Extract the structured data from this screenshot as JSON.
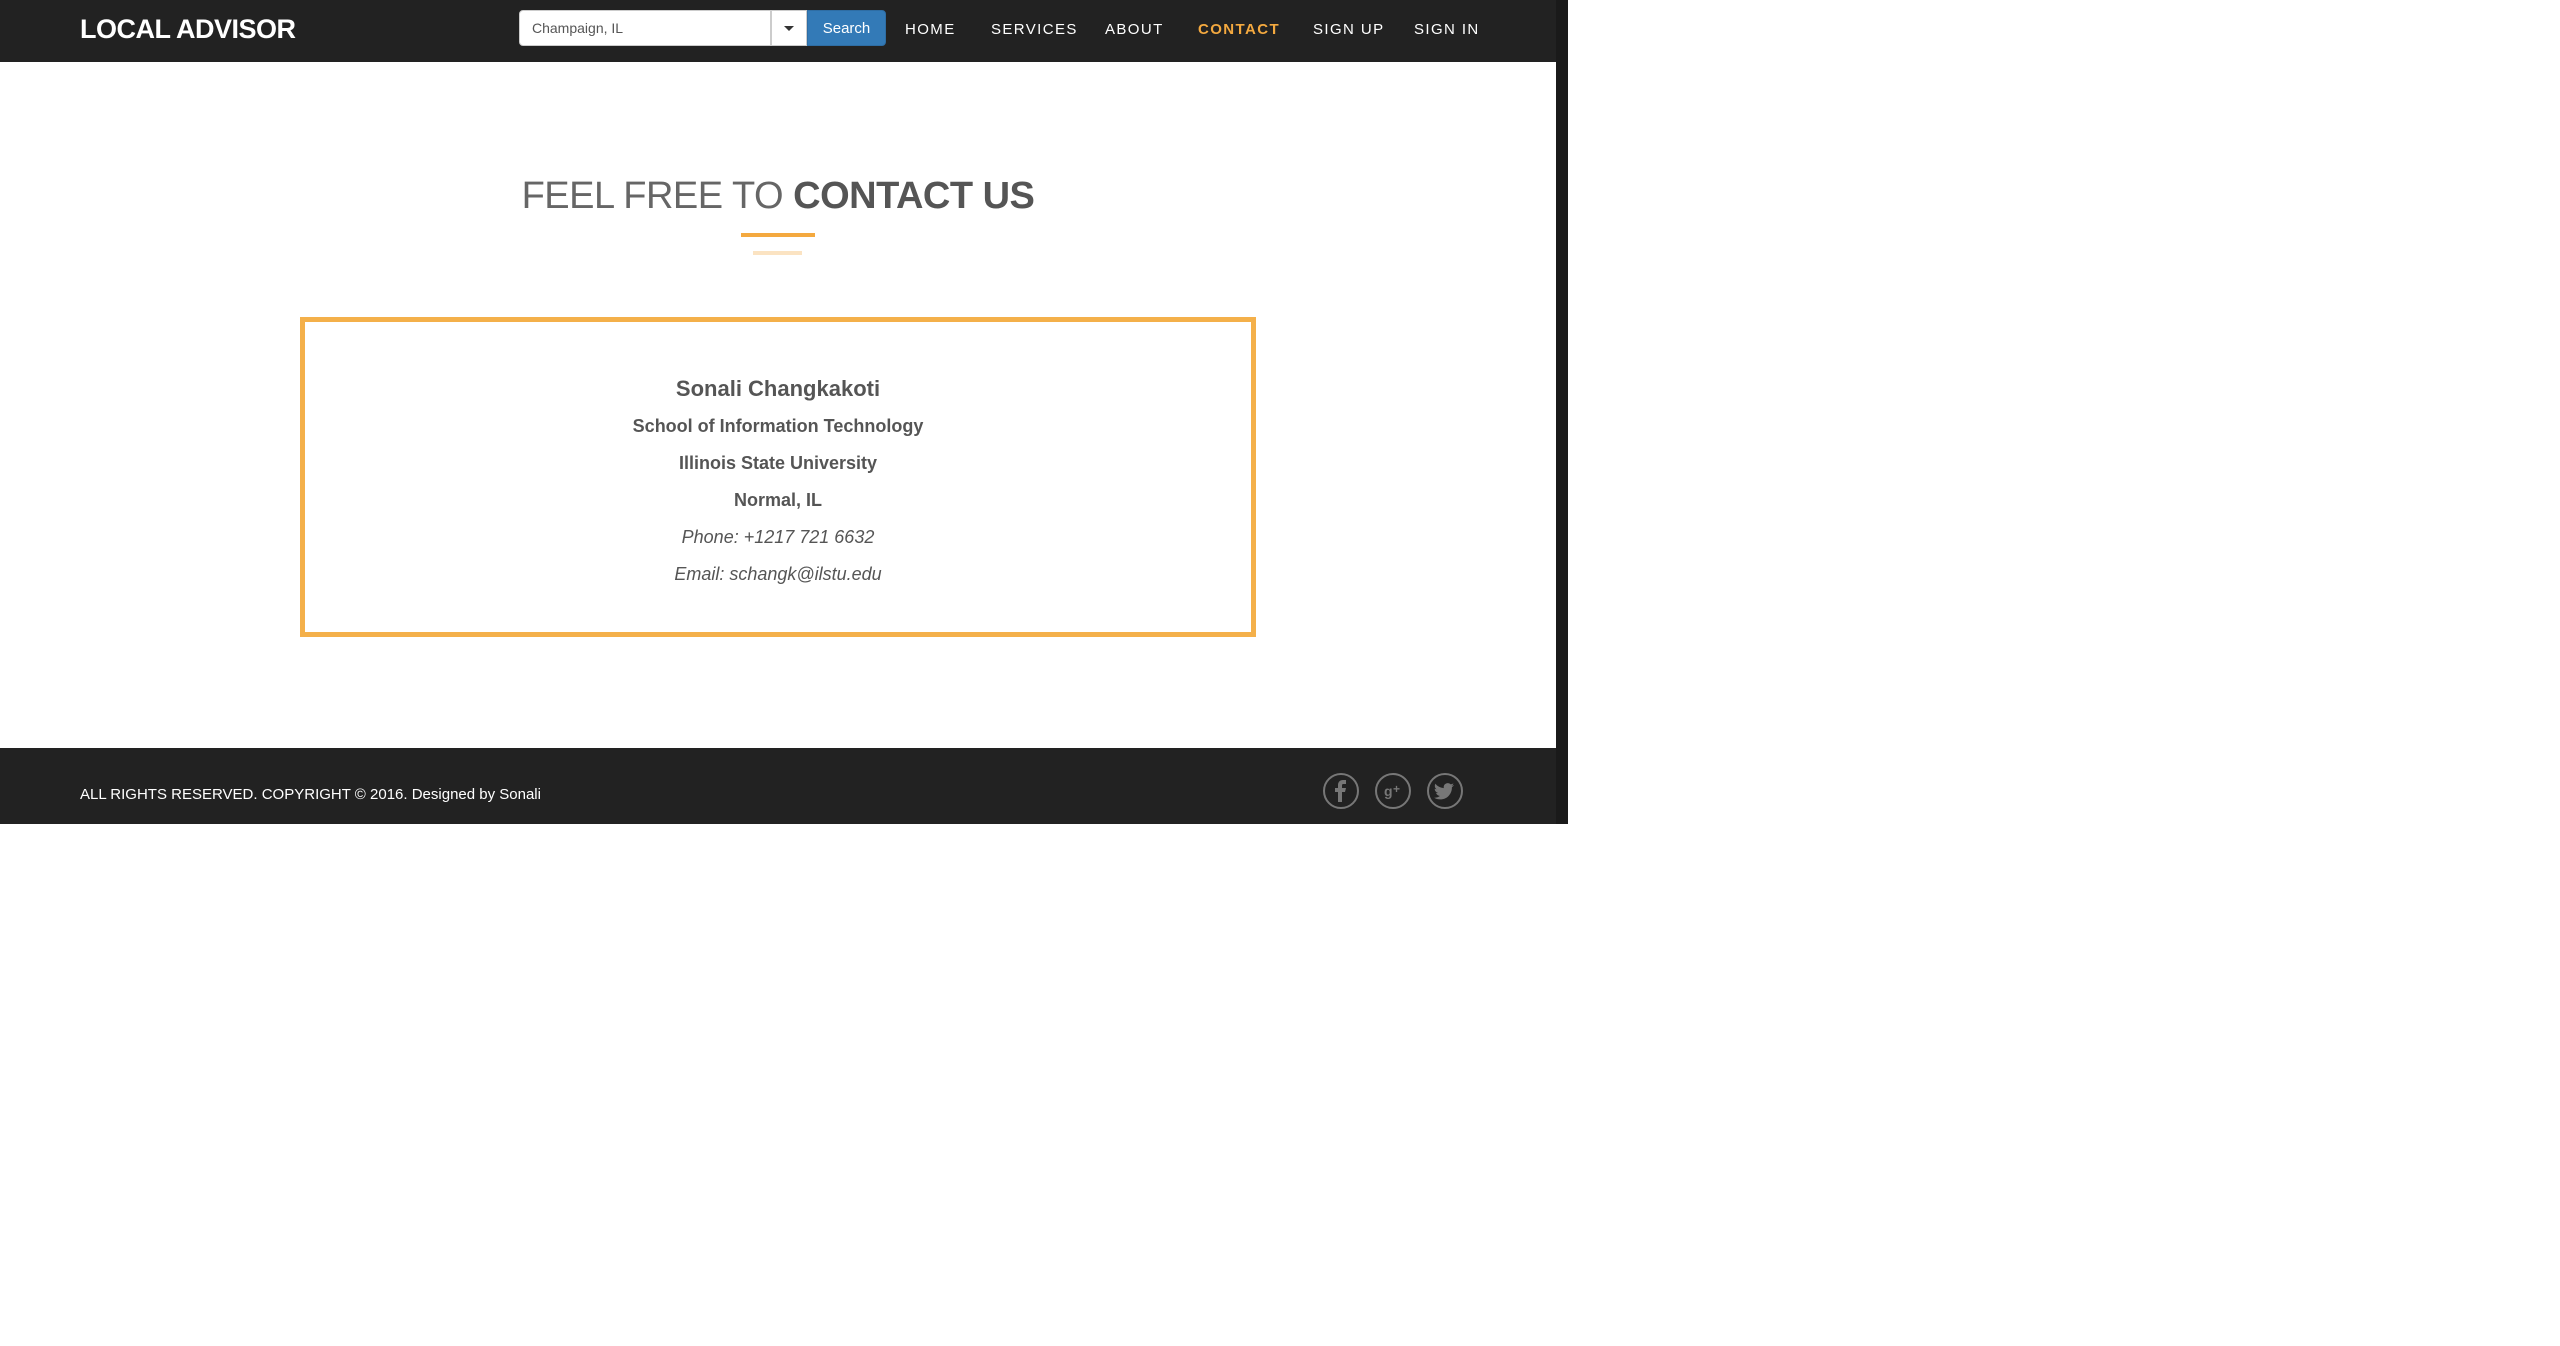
{
  "brand": "LOCAL ADVISOR",
  "search": {
    "value": "Champaign, IL",
    "button_label": "Search"
  },
  "nav": {
    "home": "HOME",
    "services": "SERVICES",
    "about": "ABOUT",
    "contact": "CONTACT",
    "signup": "SIGN UP",
    "signin": "SIGN IN",
    "active": "contact"
  },
  "heading": {
    "light": "FEEL FREE TO",
    "bold": "CONTACT US"
  },
  "contact": {
    "name": "Sonali Changkakoti",
    "school": "School of Information Technology",
    "university": "Illinois State University",
    "city": "Normal, IL",
    "phone": "Phone: +1217 721 6632",
    "email": "Email: schangk@ilstu.edu"
  },
  "footer": {
    "copyright": "ALL RIGHTS RESERVED. COPYRIGHT © 2016. Designed by Sonali",
    "social_icons": [
      "facebook-icon",
      "google-plus-icon",
      "twitter-icon"
    ]
  },
  "colors": {
    "accent": "#f4a93f",
    "nav_bg": "#222222",
    "search_button": "#337ab7"
  }
}
